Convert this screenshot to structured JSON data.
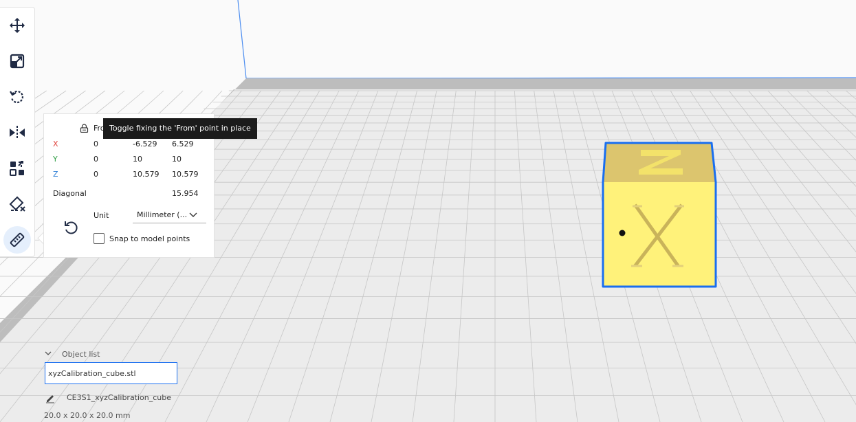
{
  "toolbar": {
    "tools": [
      {
        "name": "move-tool",
        "icon": "move-arrows-icon"
      },
      {
        "name": "scale-tool",
        "icon": "scale-icon"
      },
      {
        "name": "rotate-tool",
        "icon": "rotate-icon"
      },
      {
        "name": "mirror-tool",
        "icon": "mirror-icon"
      },
      {
        "name": "per-model-settings-tool",
        "icon": "per-model-settings-icon"
      },
      {
        "name": "support-blocker-tool",
        "icon": "support-blocker-icon"
      },
      {
        "name": "measure-tool",
        "icon": "ruler-icon",
        "active": true
      }
    ]
  },
  "measure": {
    "from_label_partial": "Fro",
    "tooltip": "Toggle fixing the 'From' point in place",
    "rows": [
      {
        "axis": "X",
        "color": "#e0433d",
        "from": "0",
        "to": "-6.529",
        "delta": "6.529"
      },
      {
        "axis": "Y",
        "color": "#2f9e44",
        "from": "0",
        "to": "10",
        "delta": "10"
      },
      {
        "axis": "Z",
        "color": "#2f7fd6",
        "from": "0",
        "to": "10.579",
        "delta": "10.579"
      }
    ],
    "diagonal_label": "Diagonal",
    "diagonal_value": "15.954",
    "unit_label": "Unit",
    "unit_value": "Millimeter (...",
    "snap_label": "Snap to model points",
    "snap_checked": false
  },
  "object_list": {
    "title": "Object list",
    "selected_object": "xyzCalibration_cube.stl",
    "job_name": "CE3S1_xyzCalibration_cube",
    "dimensions": "20.0 x 20.0 x 20.0 mm"
  },
  "colors": {
    "accent": "#196ef0",
    "model_yellow": "#fff27a",
    "model_top": "#dcc56e",
    "plate": "#e9e9e9",
    "grid": "#c9c9c9"
  }
}
